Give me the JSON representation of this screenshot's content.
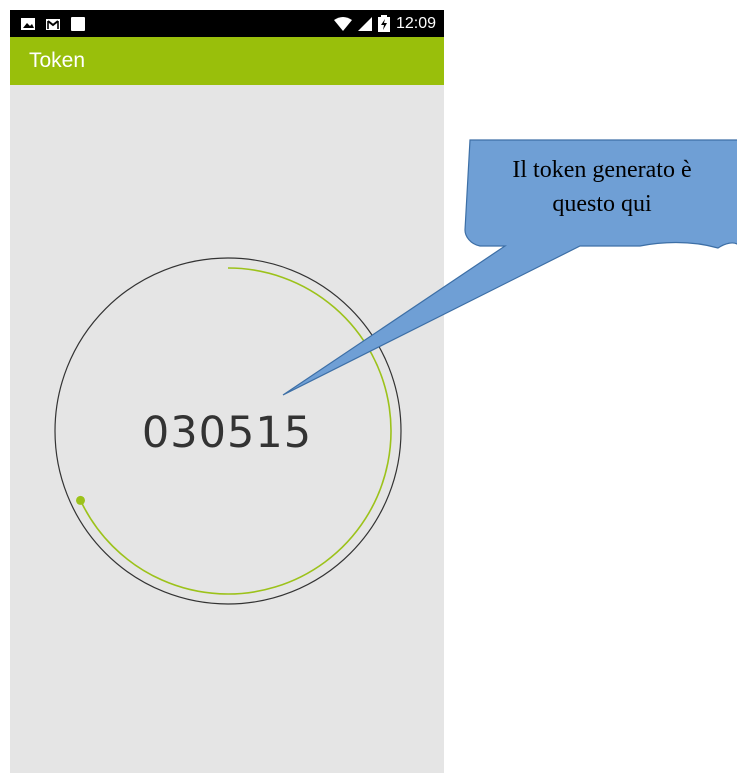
{
  "status_bar": {
    "time": "12:09",
    "left_icons": [
      "image-icon",
      "gmail-icon",
      "square-icon"
    ],
    "right_icons": [
      "wifi-icon",
      "signal-icon",
      "battery-charging-icon"
    ]
  },
  "app_bar": {
    "title": "Token"
  },
  "token": {
    "code": "030515",
    "remaining_fraction": 0.68
  },
  "annotation": {
    "lines": [
      "Il token generato è",
      "questo qui"
    ]
  },
  "colors": {
    "app_bar": "#99bf0b",
    "progress_arc": "#9cc21a",
    "background": "#e5e5e5",
    "callout_fill": "#6f9fd5"
  }
}
